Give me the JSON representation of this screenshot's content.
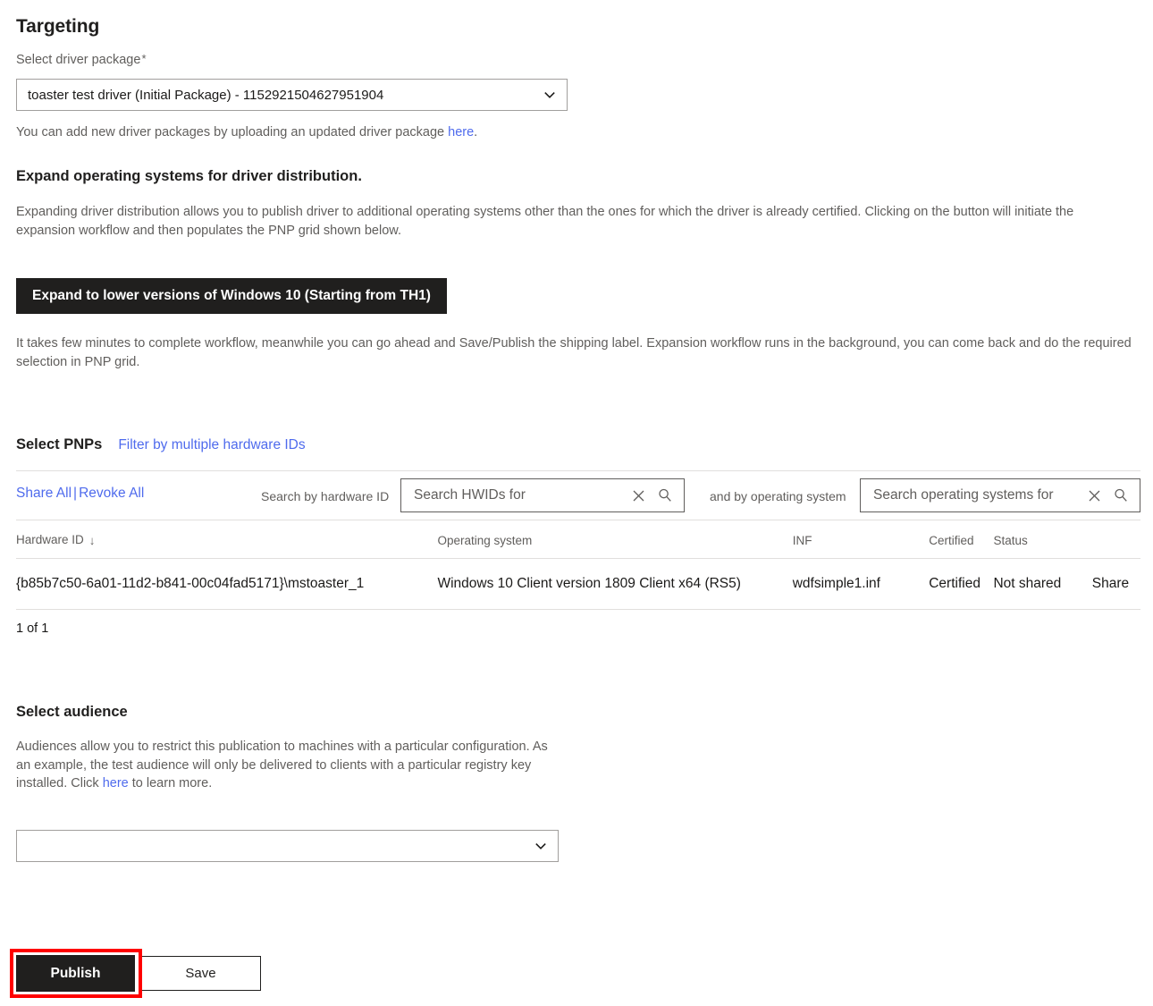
{
  "page": {
    "title": "Targeting"
  },
  "driver_package": {
    "label": "Select driver package",
    "required_mark": "*",
    "selected": "toaster test driver (Initial Package) - 1152921504627951904",
    "helper_prefix": "You can add new driver packages by uploading an updated driver package ",
    "helper_link": "here",
    "helper_suffix": "."
  },
  "expand_section": {
    "heading": "Expand operating systems for driver distribution.",
    "description": "Expanding driver distribution allows you to publish driver to additional operating systems other than the ones for which the driver is already certified. Clicking on the button will initiate the expansion workflow and then populates the PNP grid shown below.",
    "button_label": "Expand to lower versions of Windows 10 (Starting from TH1)",
    "note": "It takes few minutes to complete workflow, meanwhile you can go ahead and Save/Publish the shipping label. Expansion workflow runs in the background, you can come back and do the required selection in PNP grid."
  },
  "pnp": {
    "heading": "Select PNPs",
    "filter_link": "Filter by multiple hardware IDs",
    "share_all": "Share All",
    "separator": "|",
    "revoke_all": "Revoke All",
    "hwid_search_label": "Search by hardware ID",
    "hwid_search_placeholder": "Search HWIDs for",
    "hwid_search_value": "",
    "os_search_label": "and by operating system",
    "os_search_placeholder": "Search operating systems for",
    "os_search_value": "",
    "columns": [
      "Hardware ID",
      "Operating system",
      "INF",
      "Certified",
      "Status",
      ""
    ],
    "sort_indicator": "↓",
    "rows": [
      {
        "hardware_id": "{b85b7c50-6a01-11d2-b841-00c04fad5171}\\mstoaster_1",
        "operating_system": "Windows 10 Client version 1809 Client x64 (RS5)",
        "inf": "wdfsimple1.inf",
        "certified": "Certified",
        "status": "Not shared",
        "action": "Share"
      }
    ],
    "count_text": "1 of 1"
  },
  "audience": {
    "heading": "Select audience",
    "description_part1": "Audiences allow you to restrict this publication to machines with a particular configuration. As an example, the test audience will only be delivered to clients with a particular registry key installed. Click ",
    "description_link": "here",
    "description_part2": " to learn more.",
    "selected": ""
  },
  "footer": {
    "publish_label": "Publish",
    "save_label": "Save"
  },
  "colors": {
    "accent_link": "#4f6bed",
    "dark_button": "#201f1e",
    "highlight": "#ff0000",
    "border": "#e1dfdd",
    "muted_text": "#605e5c"
  }
}
